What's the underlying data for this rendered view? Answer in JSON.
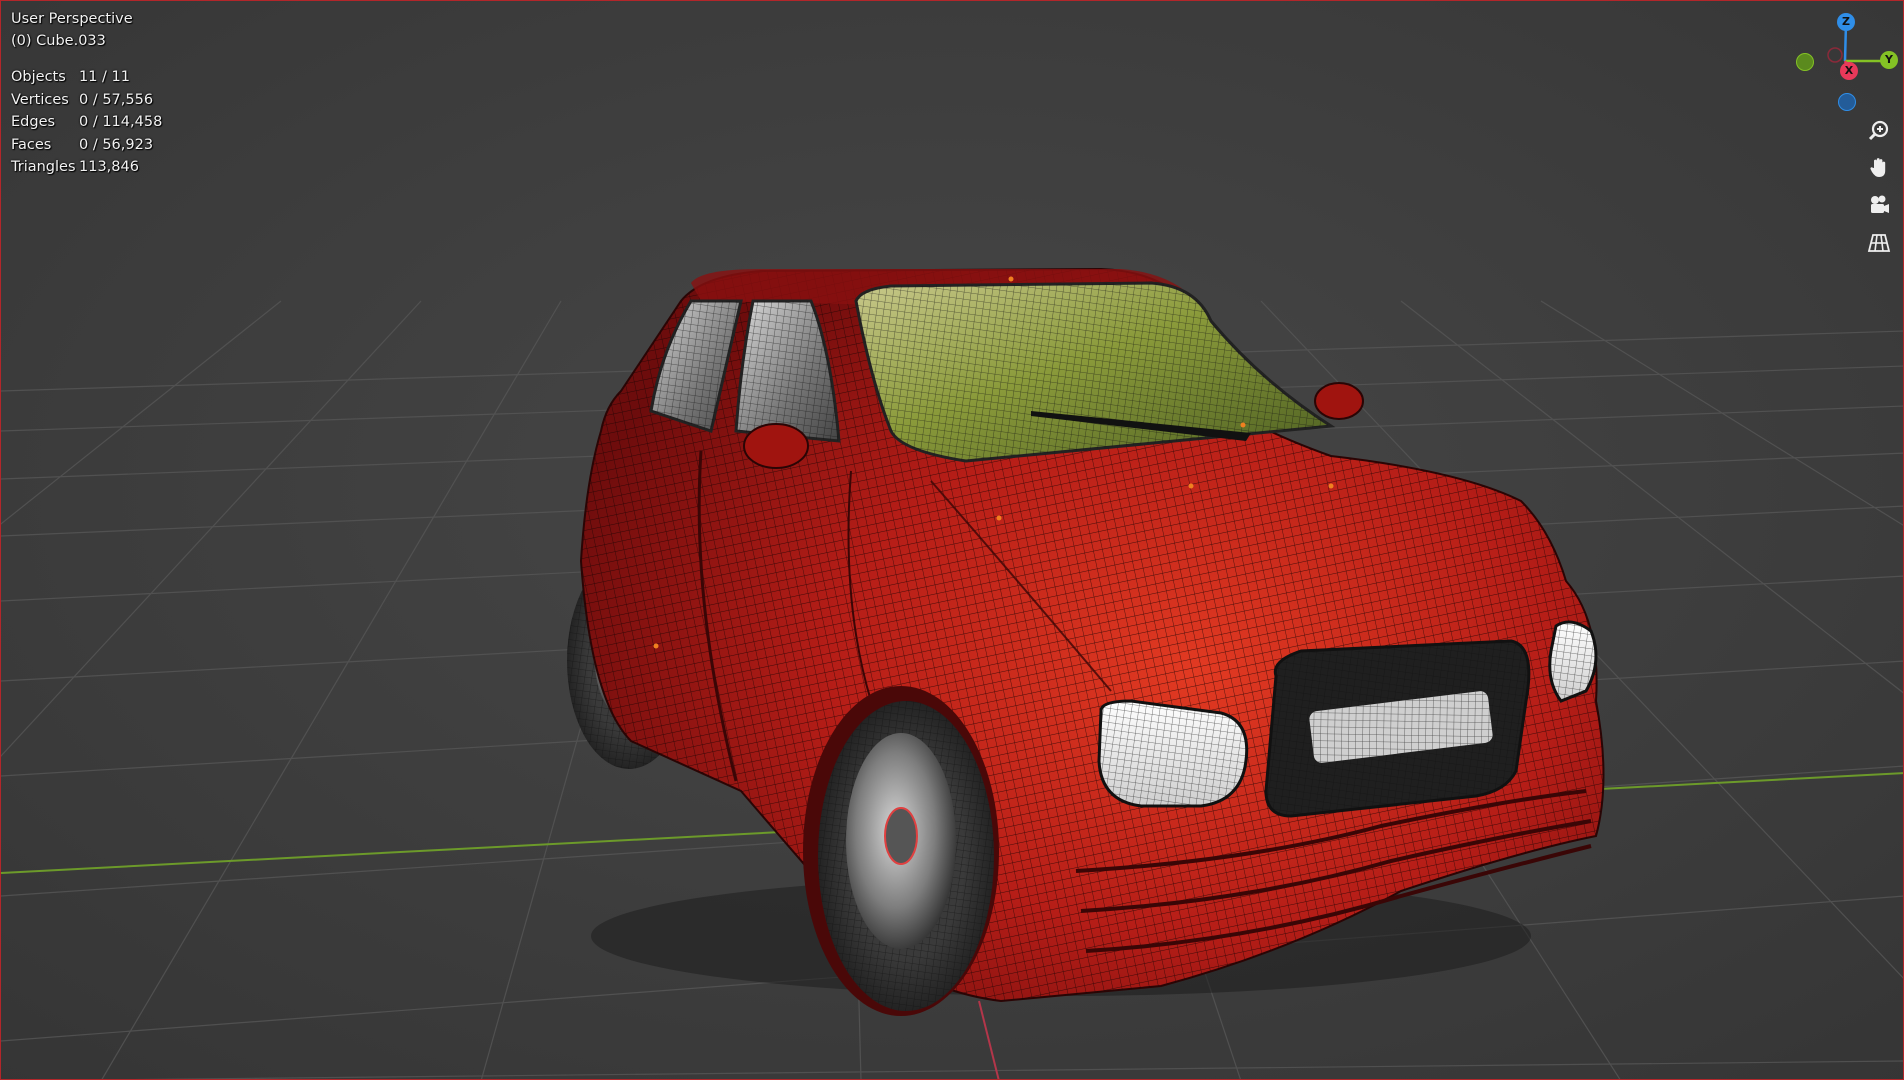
{
  "viewport": {
    "view_name": "User Perspective",
    "active_object": "(0) Cube.033"
  },
  "stats": [
    {
      "label": "Objects",
      "value": "11 / 11"
    },
    {
      "label": "Vertices",
      "value": "0 / 57,556"
    },
    {
      "label": "Edges",
      "value": "0 / 114,458"
    },
    {
      "label": "Faces",
      "value": "0 / 56,923"
    },
    {
      "label": "Triangles",
      "value": "113,846"
    }
  ],
  "gizmo": {
    "z_label": "Z",
    "y_label": "Y",
    "x_label": "X",
    "colors": {
      "x": "#e8395a",
      "y": "#84c225",
      "z": "#2f8ee8"
    }
  },
  "tools": [
    {
      "name": "zoom-icon"
    },
    {
      "name": "hand-pan-icon"
    },
    {
      "name": "camera-view-icon"
    },
    {
      "name": "perspective-grid-icon"
    }
  ],
  "colors": {
    "background": "#3d3d3d",
    "car_body": "#b81c1c",
    "outline": "#b3262a"
  }
}
